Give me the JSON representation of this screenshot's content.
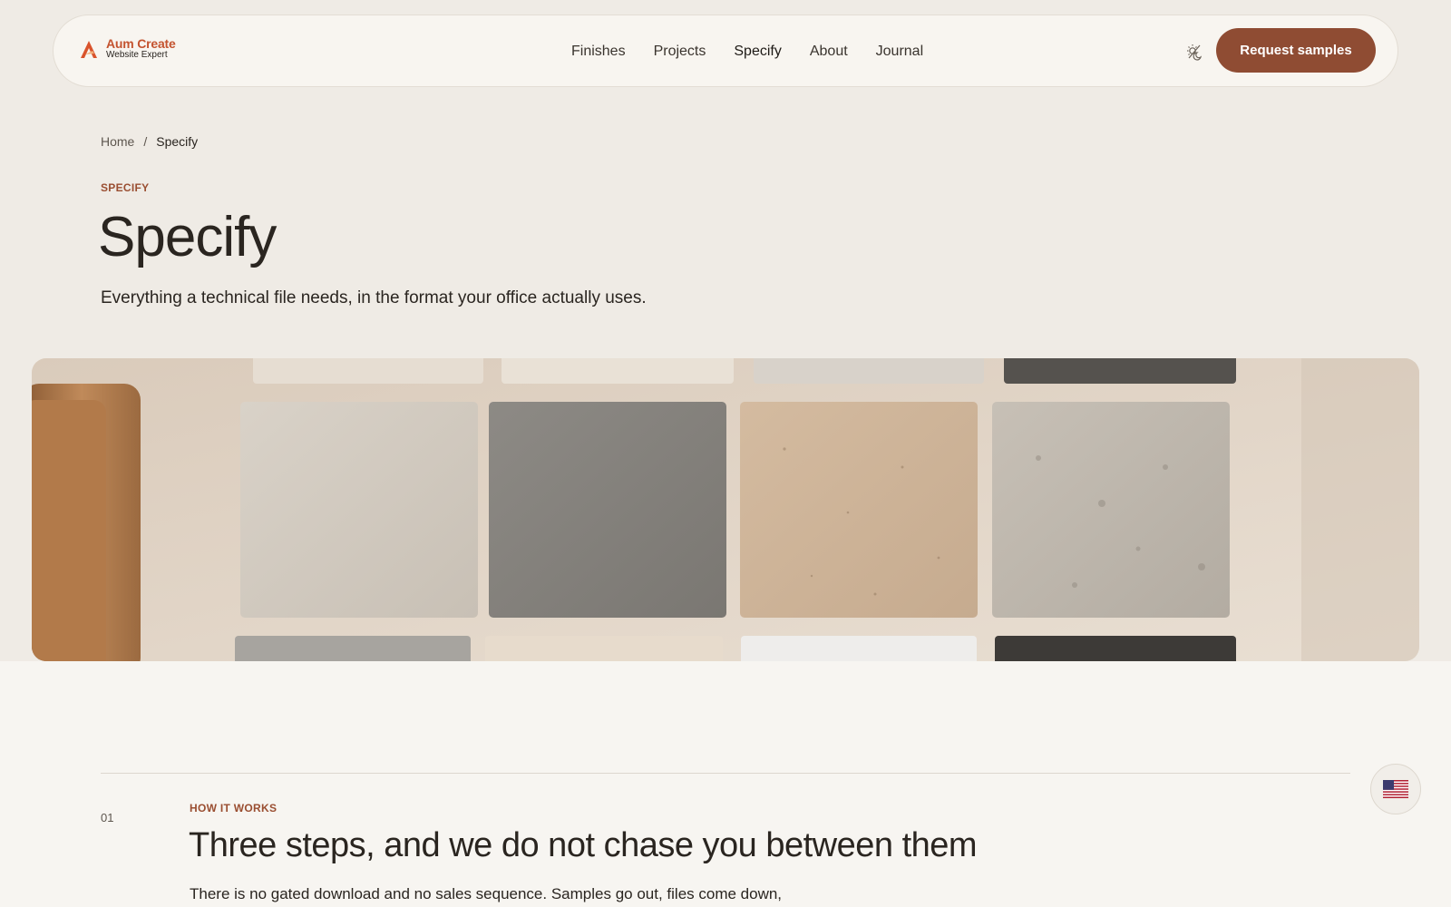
{
  "brand": {
    "name": "Aum Create",
    "tagline": "Website Expert",
    "accent": "#c4532f",
    "primary": "#8f4c33"
  },
  "nav": {
    "items": [
      {
        "label": "Finishes"
      },
      {
        "label": "Projects"
      },
      {
        "label": "Specify",
        "active": true
      },
      {
        "label": "About"
      },
      {
        "label": "Journal"
      }
    ],
    "theme_toggle_icon": "sun-moon-icon",
    "cta_label": "Request samples"
  },
  "breadcrumb": {
    "home": "Home",
    "separator": "/",
    "current": "Specify"
  },
  "hero": {
    "eyebrow": "SPECIFY",
    "title": "Specify",
    "lede": "Everything a technical file needs, in the format your office actually uses.",
    "image": "stone-sample-tiles-photo"
  },
  "section": {
    "number": "01",
    "eyebrow": "HOW IT WORKS",
    "title": "Three steps, and we do not chase you between them",
    "body": "There is no gated download and no sales sequence. Samples go out, files come down,"
  },
  "language_button": {
    "icon": "us-flag-icon"
  }
}
